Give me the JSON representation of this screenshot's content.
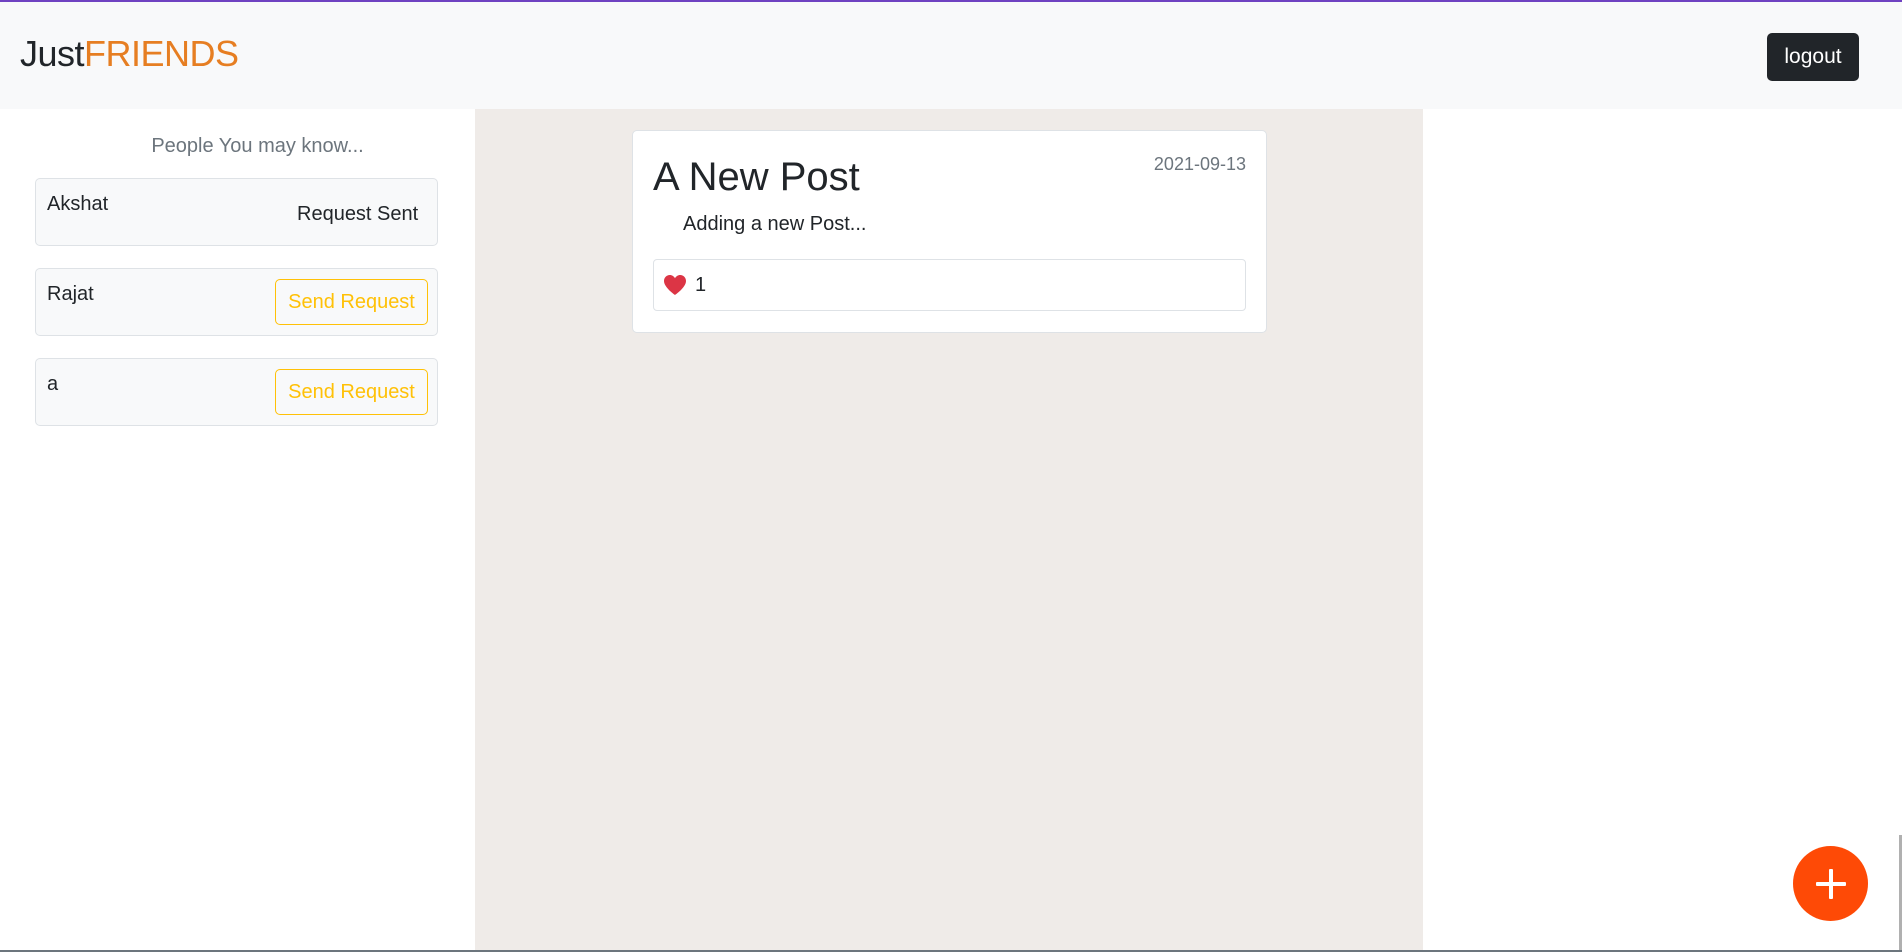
{
  "header": {
    "brand_part1": "Just",
    "brand_part2": "FRIENDS",
    "logout_label": "logout"
  },
  "sidebar": {
    "title": "People You may know...",
    "people": [
      {
        "name": "Akshat",
        "status": "Request Sent"
      },
      {
        "name": "Rajat",
        "action": "Send Request"
      },
      {
        "name": "a",
        "action": "Send Request"
      }
    ]
  },
  "feed": {
    "posts": [
      {
        "title": "A New Post",
        "date": "2021-09-13",
        "body": "Adding a new Post...",
        "likes": "1",
        "like_icon": "heart-icon"
      }
    ]
  },
  "fab": {
    "icon": "plus-icon"
  },
  "colors": {
    "brand_accent": "#e67e22",
    "nav_bg": "#f8f9fa",
    "feed_bg": "#efebe8",
    "send_request": "#ffc107",
    "like_heart": "#dc3545",
    "fab_bg": "#fe4a06",
    "logout_bg": "#212529",
    "top_accent": "#6f42c1"
  }
}
